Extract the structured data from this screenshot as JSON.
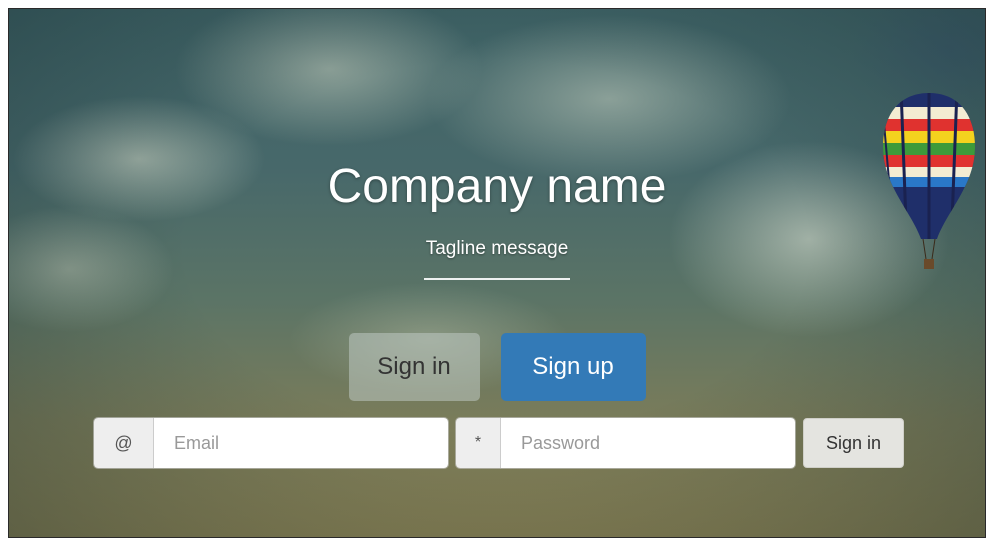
{
  "hero": {
    "title": "Company name",
    "tagline": "Tagline message"
  },
  "actions": {
    "signin_label": "Sign in",
    "signup_label": "Sign up"
  },
  "form": {
    "email_addon": "@",
    "email_placeholder": "Email",
    "password_addon": "*",
    "password_placeholder": "Password",
    "submit_label": "Sign in"
  },
  "colors": {
    "primary": "#337ab7",
    "secondary_button": "#e4e4e0",
    "text_light": "#ffffff"
  },
  "background": {
    "image": "cloudy-sky-with-hot-air-balloon"
  }
}
